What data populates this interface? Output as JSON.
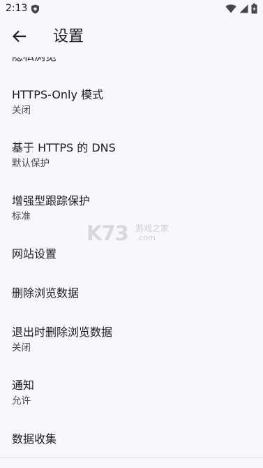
{
  "status_bar": {
    "time": "2:13"
  },
  "header": {
    "title": "设置"
  },
  "list": {
    "partial_item": "隐私浏览",
    "items": [
      {
        "title": "HTTPS-Only 模式",
        "subtitle": "关闭"
      },
      {
        "title": "基于 HTTPS 的 DNS",
        "subtitle": "默认保护"
      },
      {
        "title": "增强型跟踪保护",
        "subtitle": "标准"
      },
      {
        "title": "网站设置"
      },
      {
        "title": "删除浏览数据"
      },
      {
        "title": "退出时删除浏览数据",
        "subtitle": "关闭"
      },
      {
        "title": "通知",
        "subtitle": "允许"
      },
      {
        "title": "数据收集"
      }
    ]
  },
  "watermark": {
    "logo": "K73",
    "text": "游戏之家",
    "domain": ".com"
  }
}
